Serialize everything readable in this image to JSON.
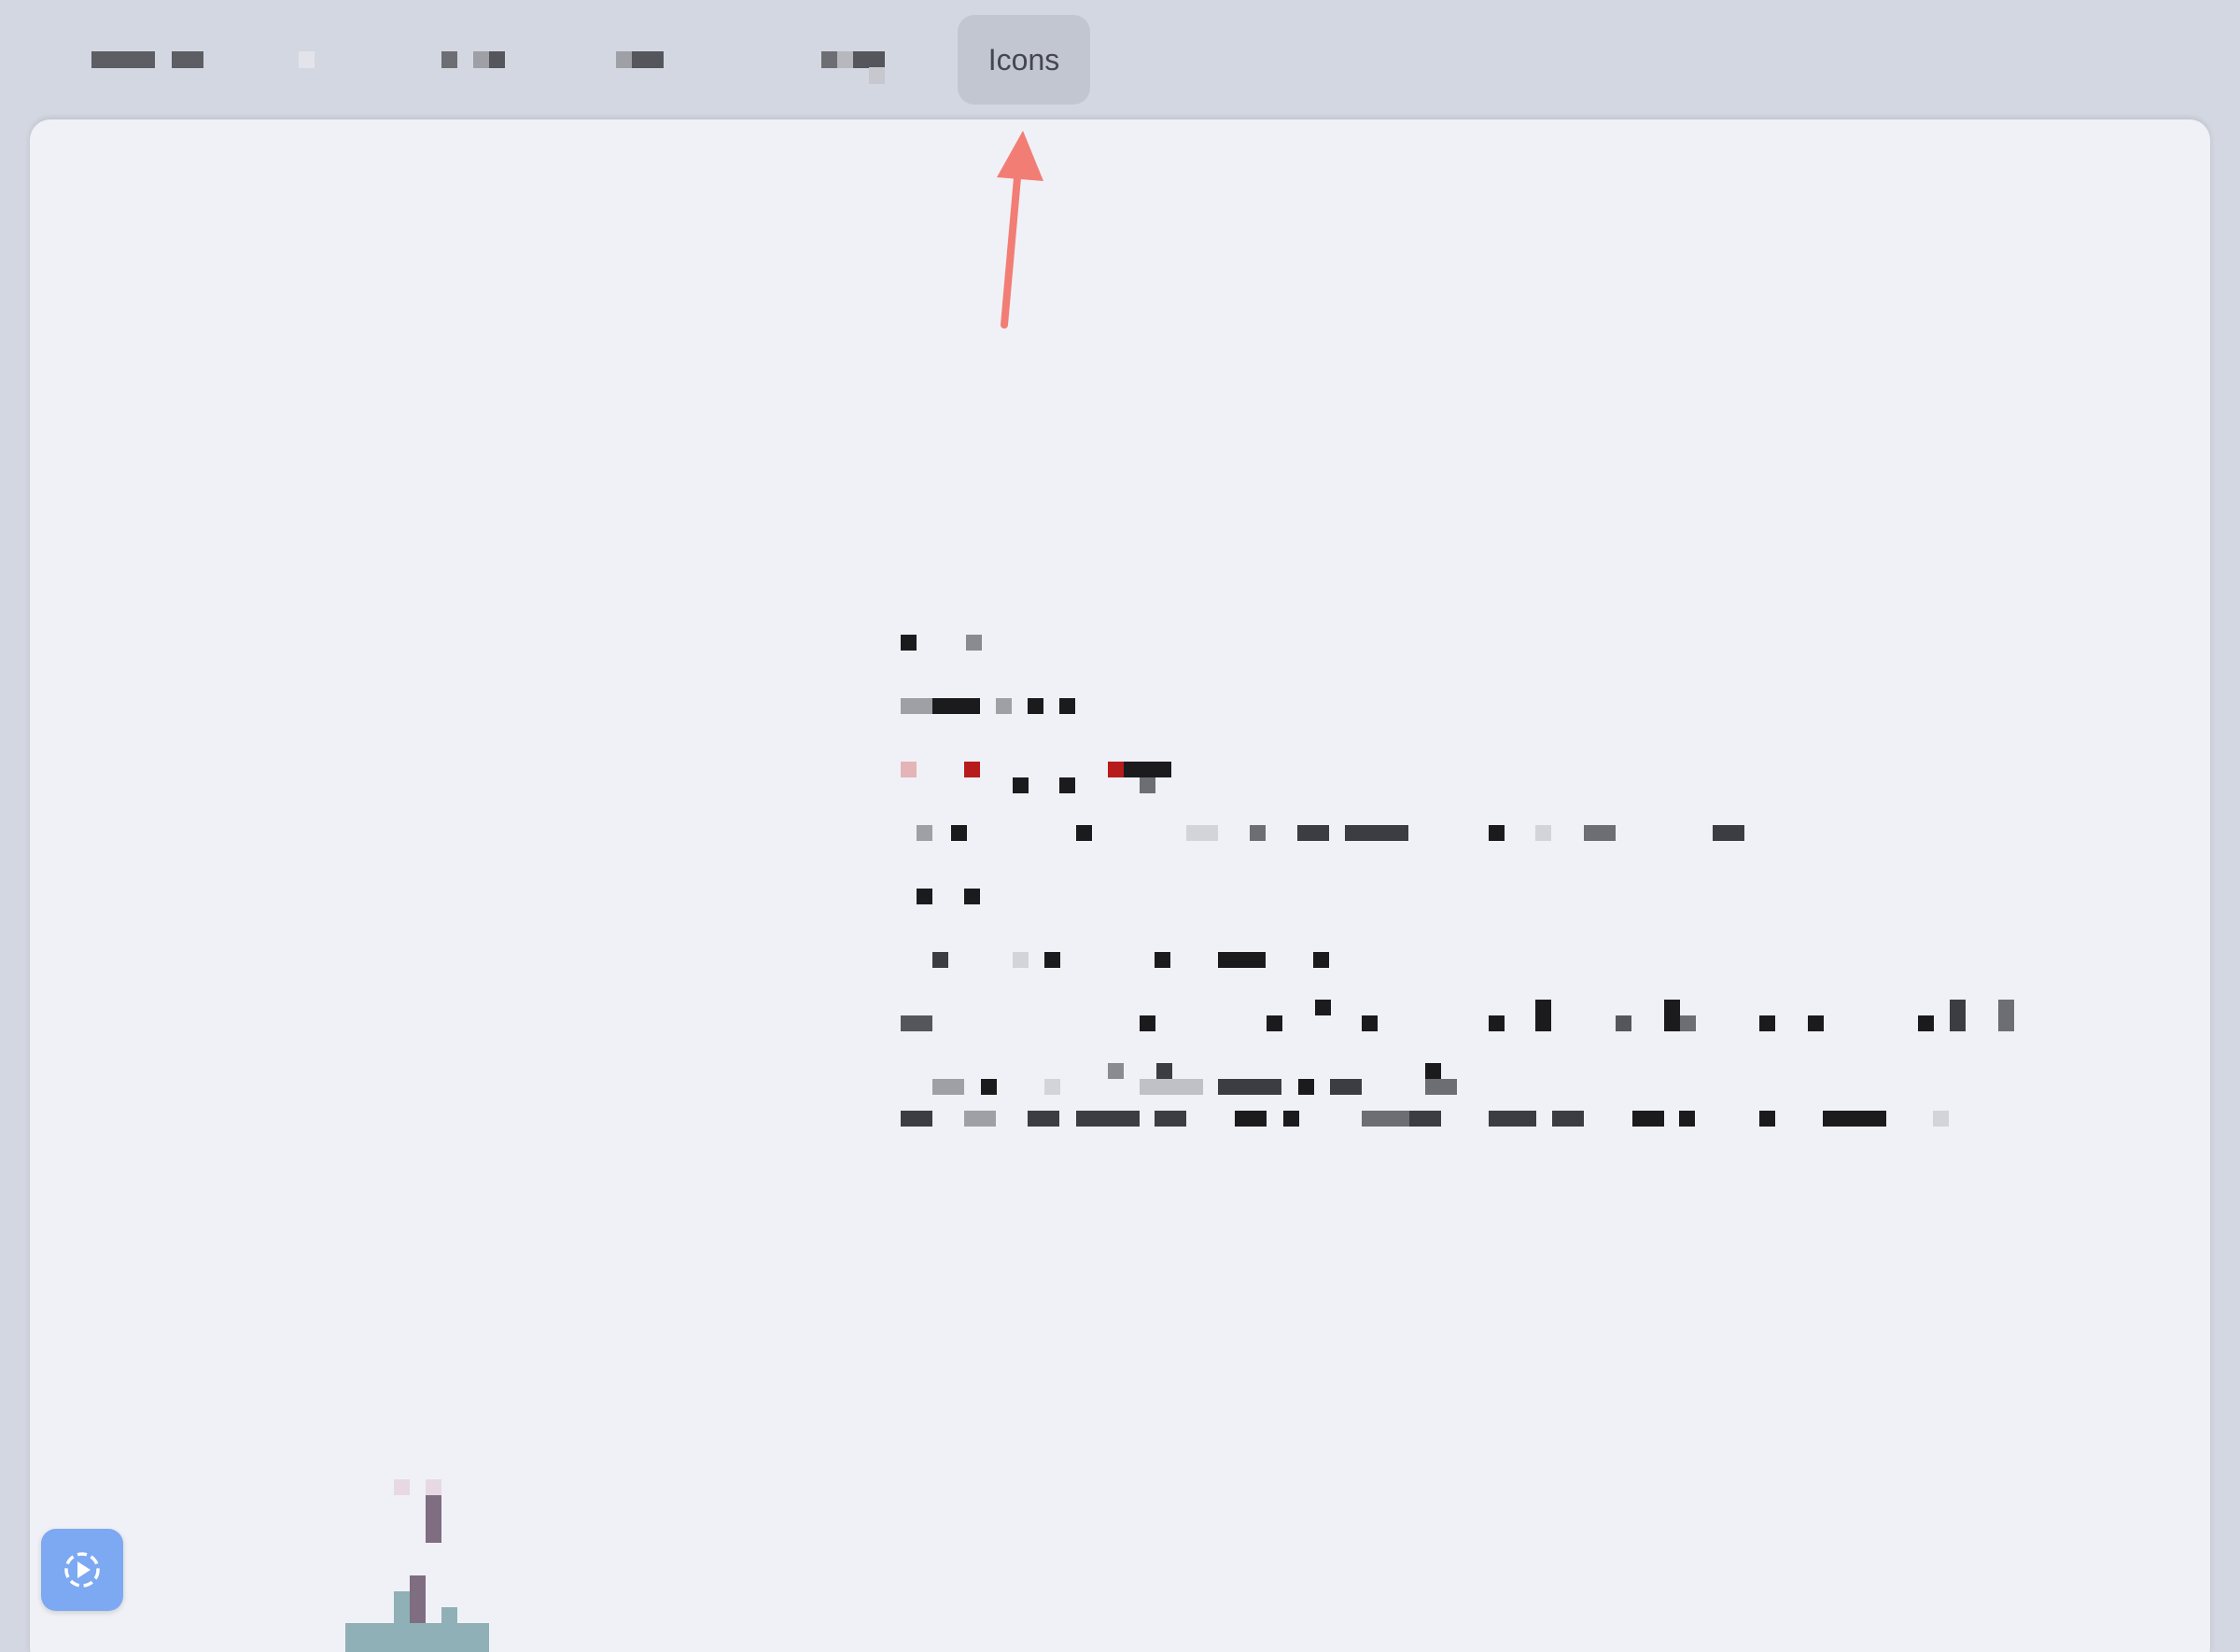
{
  "tabbar": {
    "tabs": [
      {
        "label": ""
      },
      {
        "label": ""
      },
      {
        "label": ""
      },
      {
        "label": ""
      },
      {
        "label": ""
      },
      {
        "label": "Icons",
        "active": true
      }
    ]
  },
  "content": {
    "lines": [
      "",
      "",
      "",
      "",
      "",
      "",
      "",
      "",
      ""
    ]
  },
  "launcher": {
    "icon": "play-circle-icon"
  },
  "colors": {
    "background": "#d3d7e1",
    "panel": "#f0f1f6",
    "active_tab": "#c2c6d0",
    "arrow": "#f27d75",
    "launcher": "#7ca9f2"
  }
}
